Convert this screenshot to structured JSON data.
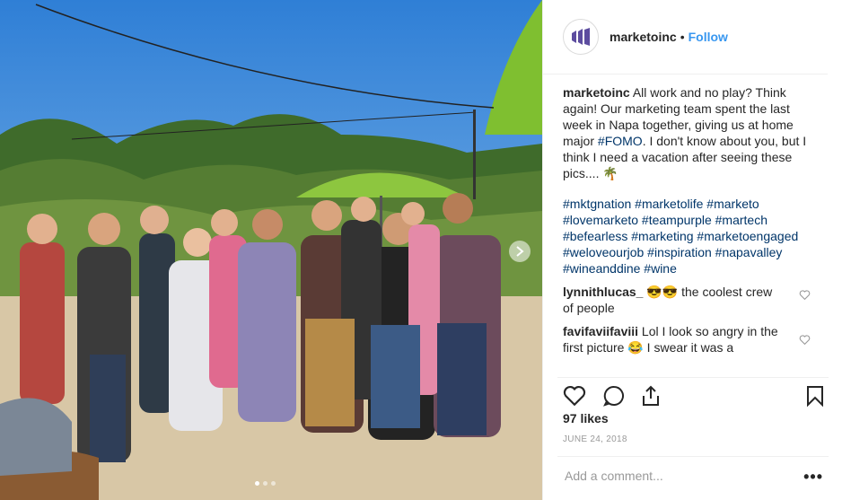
{
  "photo": {
    "alt": "Team photo in a vineyard",
    "carousel_count": 3,
    "carousel_active": 0
  },
  "header": {
    "username": "marketoinc",
    "separator": "•",
    "follow_label": "Follow",
    "avatar_icon": "marketo-logo-icon"
  },
  "caption": {
    "username": "marketoinc",
    "text_1": " All work and no play? Think again! Our marketing team spent the last week in Napa together, giving us at home major ",
    "fomo": "#FOMO",
    "text_2": ". I don't know about you, but I think I need a vacation after seeing these pics.... 🌴",
    "hashtags": "#mktgnation #marketolife #marketo #lovemarketo #teampurple #martech #befearless #marketing #marketoengaged #weloveourjob #inspiration #napavalley #wineanddine #wine"
  },
  "comments": [
    {
      "username": "lynnithlucas_",
      "text": " 😎😎 the coolest crew of people"
    },
    {
      "username": "favifaviifaviii",
      "text": " Lol I look so angry in the first picture 😂 I swear it was a"
    }
  ],
  "actions": {
    "like_icon": "heart-outline-icon",
    "comment_icon": "comment-bubble-icon",
    "share_icon": "share-icon",
    "save_icon": "bookmark-icon"
  },
  "likes": "97 likes",
  "date": "JUNE 24, 2018",
  "add_comment": {
    "placeholder": "Add a comment...",
    "more_label": "•••"
  },
  "colors": {
    "link": "#3897f0",
    "hashtag": "#003569",
    "brand_purple": "#5c4c9f"
  }
}
